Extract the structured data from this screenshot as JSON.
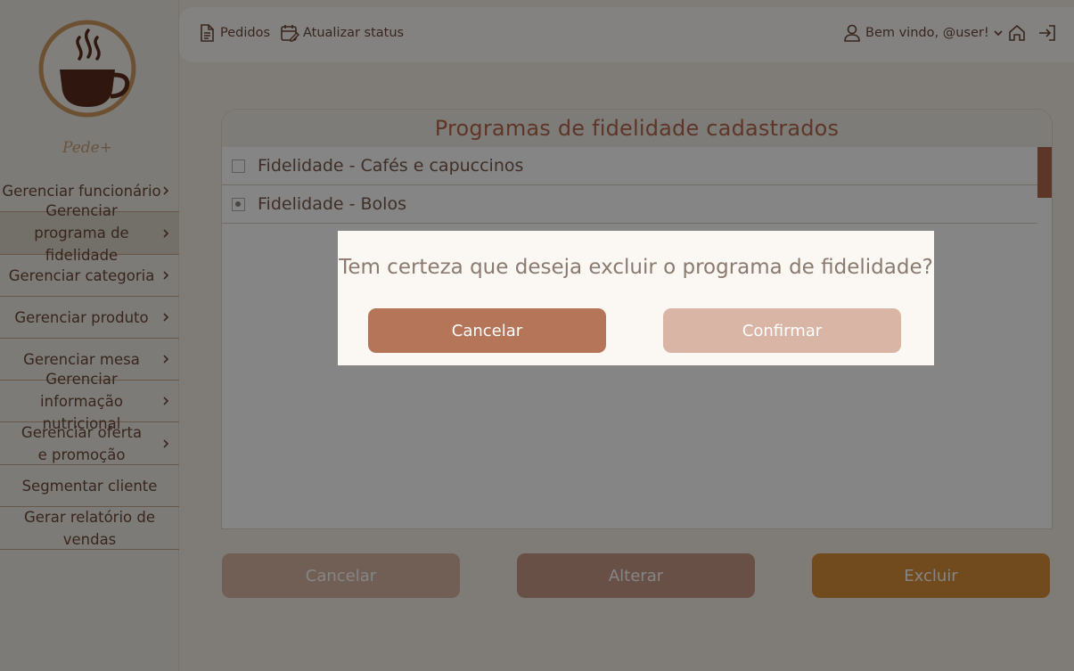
{
  "brand": {
    "logo_text": "Pede+"
  },
  "sidebar": {
    "items": [
      {
        "label": "Gerenciar funcionário",
        "active": false,
        "chevron": true
      },
      {
        "label": "Gerenciar programa de fidelidade",
        "active": true,
        "chevron": true
      },
      {
        "label": "Gerenciar categoria",
        "active": false,
        "chevron": true
      },
      {
        "label": "Gerenciar produto",
        "active": false,
        "chevron": true
      },
      {
        "label": "Gerenciar mesa",
        "active": false,
        "chevron": true
      },
      {
        "label": "Gerenciar informação nutricional",
        "active": false,
        "chevron": true
      },
      {
        "label": "Gerenciar oferta e promoção",
        "active": false,
        "chevron": true
      },
      {
        "label": "Segmentar cliente",
        "active": false,
        "chevron": false
      },
      {
        "label": "Gerar relatório de vendas",
        "active": false,
        "chevron": false
      }
    ]
  },
  "topbar": {
    "orders_label": "Pedidos",
    "update_status_label": "Atualizar status",
    "welcome_label": "Bem vindo, @user!"
  },
  "panel": {
    "title": "Programas de fidelidade cadastrados",
    "programs": [
      {
        "name": "Fidelidade - Cafés e capuccinos",
        "selected": false
      },
      {
        "name": "Fidelidade - Bolos",
        "selected": true
      }
    ]
  },
  "actions": {
    "cancel_label": "Cancelar",
    "alter_label": "Alterar",
    "delete_label": "Excluir"
  },
  "dialog": {
    "message": "Tem certeza que deseja excluir o programa de fidelidade?",
    "cancel_label": "Cancelar",
    "confirm_label": "Confirmar"
  },
  "colors": {
    "accent": "#b5694e",
    "primary_button": "#b57558",
    "delete_button": "#d98e3a"
  }
}
